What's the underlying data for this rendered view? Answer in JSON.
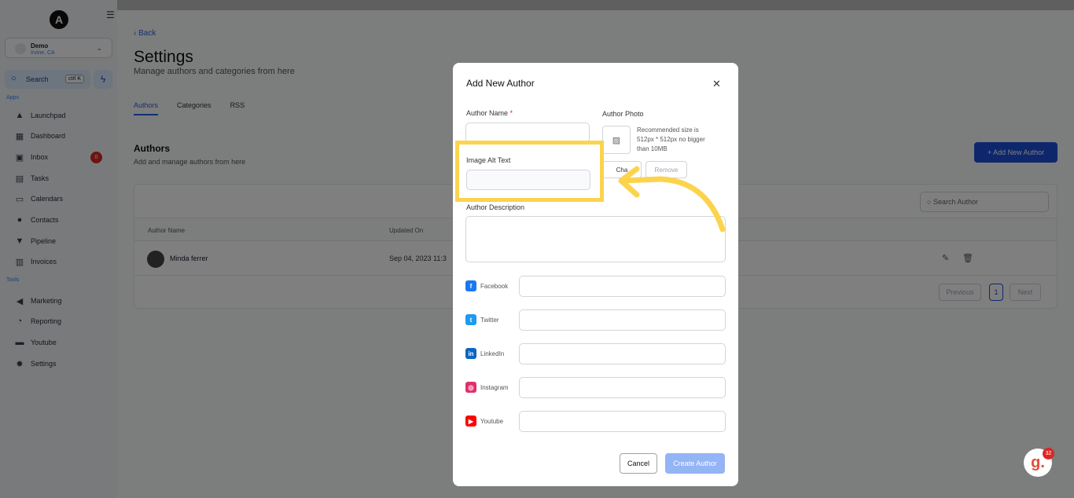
{
  "sidebar": {
    "logo": "A",
    "account": {
      "name": "Demo",
      "location": "Irvine, CA"
    },
    "search": {
      "label": "Search",
      "shortcut": "ctrl K"
    },
    "apps_label": "Apps",
    "tools_label": "Tools",
    "apps": [
      {
        "label": "Launchpad",
        "icon": "rocket-icon"
      },
      {
        "label": "Dashboard",
        "icon": "grid-icon"
      },
      {
        "label": "Inbox",
        "icon": "inbox-icon",
        "badge": "0"
      },
      {
        "label": "Tasks",
        "icon": "clipboard-icon"
      },
      {
        "label": "Calendars",
        "icon": "calendar-icon"
      },
      {
        "label": "Contacts",
        "icon": "person-icon"
      },
      {
        "label": "Pipeline",
        "icon": "funnel-icon"
      },
      {
        "label": "Invoices",
        "icon": "document-icon"
      }
    ],
    "tools": [
      {
        "label": "Marketing",
        "icon": "megaphone-icon"
      },
      {
        "label": "Reporting",
        "icon": "chart-icon"
      },
      {
        "label": "Youtube",
        "icon": "video-icon"
      },
      {
        "label": "Settings",
        "icon": "gear-icon"
      }
    ]
  },
  "page": {
    "back": "Back",
    "title": "Settings",
    "subtitle": "Manage authors and categories from here",
    "tabs": [
      "Authors",
      "Categories",
      "RSS"
    ],
    "section_title": "Authors",
    "section_subtitle": "Add and manage authors from here",
    "add_button": "+ Add New Author",
    "search_placeholder": "Search Author",
    "columns": [
      "Author Name",
      "Updated On"
    ],
    "rows": [
      {
        "name": "Minda ferrer",
        "updated": "Sep 04, 2023 11:3"
      }
    ],
    "pagination": {
      "previous": "Previous",
      "current": "1",
      "next": "Next"
    }
  },
  "modal": {
    "title": "Add New Author",
    "author_name_label": "Author Name",
    "required_mark": "*",
    "author_photo_label": "Author Photo",
    "photo_note": "Recommended size is 512px * 512px no bigger than 10MB",
    "change_button": "Cha",
    "remove_button": "Remove",
    "image_alt_label": "Image Alt Text",
    "description_label": "Author Description",
    "socials": [
      {
        "label": "Facebook",
        "color": "#1877f2",
        "glyph": "f"
      },
      {
        "label": "Twitter",
        "color": "#1d9bf0",
        "glyph": "t"
      },
      {
        "label": "LinkedIn",
        "color": "#0a66c2",
        "glyph": "in"
      },
      {
        "label": "Instagram",
        "color": "#e1306c",
        "glyph": "◎"
      },
      {
        "label": "Youtube",
        "color": "#ff0000",
        "glyph": "▶"
      }
    ],
    "cancel_button": "Cancel",
    "create_button": "Create Author"
  },
  "help_widget": {
    "glyph": "g.",
    "badge": "32"
  },
  "colors": {
    "accent": "#1d4ed8",
    "highlight": "#fcd34d"
  }
}
